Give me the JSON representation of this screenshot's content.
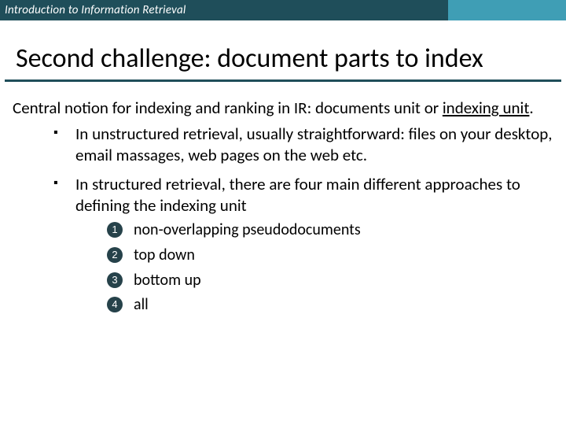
{
  "header": {
    "course": "Introduction to Information Retrieval"
  },
  "title": "Second challenge: document parts to index",
  "intro": {
    "prefix": "Central notion for indexing and ranking in IR: documents unit or ",
    "underlined": "indexing unit",
    "suffix": "."
  },
  "bullets": [
    "In unstructured retrieval, usually straightforward: files on your desktop, email massages, web pages on the web etc.",
    "In structured retrieval, there are four main different approaches to defining the indexing unit"
  ],
  "approaches": [
    "non-overlapping pseudodocuments",
    "top down",
    "bottom up",
    "all"
  ]
}
